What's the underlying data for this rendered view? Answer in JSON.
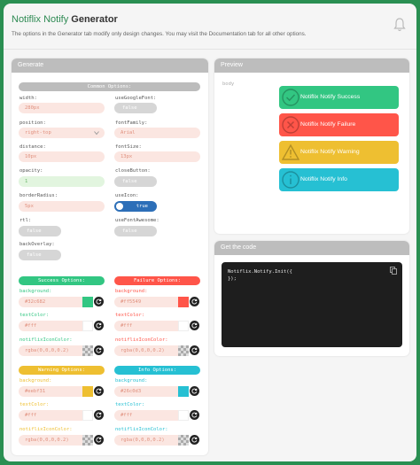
{
  "header": {
    "title_brand": "Notiflix",
    "title_product": "Notify",
    "title_rest": "Generator",
    "subtitle": "The options in the Generator tab modify only design changes. You may visit the Documentation tab for all other options."
  },
  "generate": {
    "title": "Generate",
    "common_header": "Common Options:",
    "width_label": "width:",
    "width_value": "280px",
    "position_label": "position:",
    "position_value": "right-top",
    "distance_label": "distance:",
    "distance_value": "10px",
    "opacity_label": "opacity:",
    "opacity_value": "1",
    "borderRadius_label": "borderRadius:",
    "borderRadius_value": "5px",
    "rtl_label": "rtl:",
    "rtl_value": "false",
    "backOverlay_label": "backOverlay:",
    "backOverlay_value": "false",
    "useGoogleFont_label": "useGoogleFont:",
    "useGoogleFont_value": "false",
    "fontFamily_label": "fontFamily:",
    "fontFamily_value": "Arial",
    "fontSize_label": "fontSize:",
    "fontSize_value": "13px",
    "closeButton_label": "closeButton:",
    "closeButton_value": "false",
    "useIcon_label": "useIcon:",
    "useIcon_value": "true",
    "useFontAwesome_label": "useFontAwesome:",
    "useFontAwesome_value": "false",
    "bg_label": "background:",
    "textColor_label": "textColor:",
    "iconColor_label": "notiflixIconColor:",
    "success": {
      "header": "Success Options:",
      "color": "#32c682",
      "bg": "#32c682",
      "text": "#fff",
      "icon": "rgba(0,0,0,0.2)"
    },
    "failure": {
      "header": "Failure Options:",
      "color": "#ff5549",
      "bg": "#ff5549",
      "text": "#fff",
      "icon": "rgba(0,0,0,0.2)"
    },
    "warning": {
      "header": "Warning Options:",
      "color": "#eebf31",
      "bg": "#eebf31",
      "text": "#fff",
      "icon": "rgba(0,0,0,0.2)"
    },
    "info": {
      "header": "Info Options:",
      "color": "#26c0d3",
      "bg": "#26c0d3",
      "text": "#fff",
      "icon": "rgba(0,0,0,0.2)"
    }
  },
  "preview": {
    "title": "Preview",
    "body_label": "body",
    "success": "Notiflix Notify Success",
    "failure": "Notiflix Notify Failure",
    "warning": "Notiflix Notify Warning",
    "info": "Notiflix Notify Info"
  },
  "code": {
    "title": "Get the code",
    "line1": "Notiflix.Notify.Init({",
    "line2": "});"
  }
}
